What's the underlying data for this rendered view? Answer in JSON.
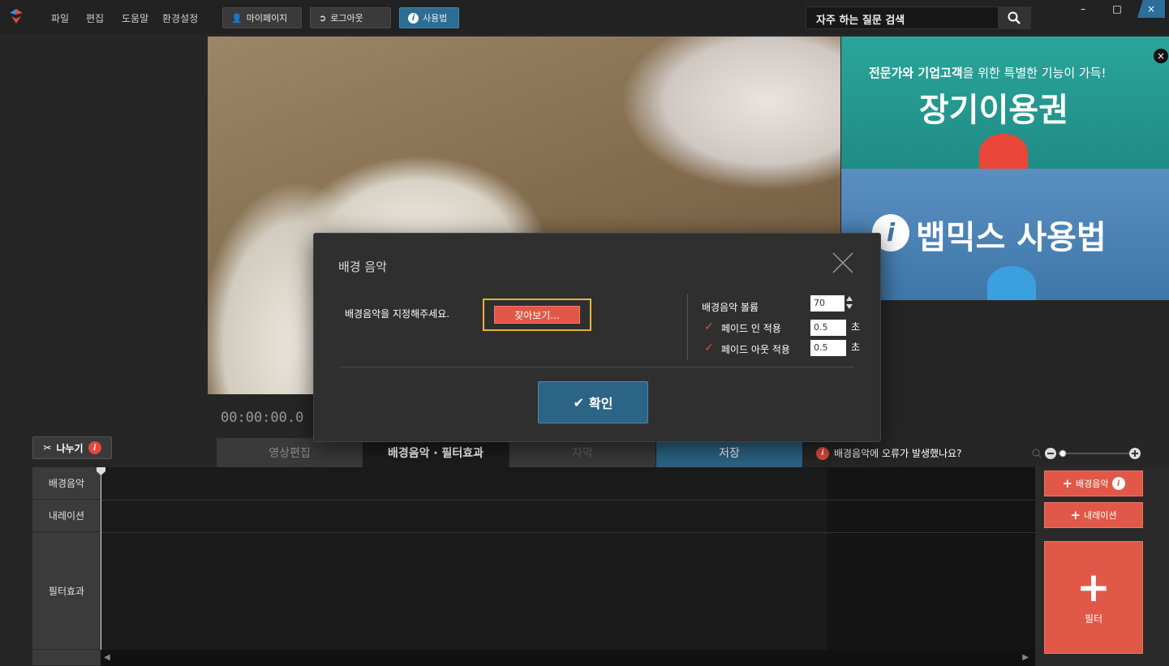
{
  "menu": [
    "파일",
    "편집",
    "도움말",
    "환경설정"
  ],
  "topbar": {
    "mypage": "마이페이지",
    "logout": "로그아웃",
    "howto": "사용법"
  },
  "search": {
    "label": "자주 하는 질문 검색"
  },
  "window": {
    "minimize": "–",
    "maximize": "□",
    "close": "×"
  },
  "ads": {
    "ad1_sub_prefix": "전문가와 기업고객",
    "ad1_sub_suffix": "을 위한 특별한 기능이 가득!",
    "ad1_main": "장기이용권",
    "ad2_main": "뱁믹스 사용법",
    "close": "×"
  },
  "player": {
    "timecode": "00:00:00.0"
  },
  "split": {
    "label": "나누기"
  },
  "tabs": [
    {
      "label": "영상편집"
    },
    {
      "label": "배경음악 · 필터효과"
    },
    {
      "label": "자막"
    },
    {
      "label": "저장"
    }
  ],
  "error_help": "배경음악에 오류가 발생했나요?",
  "timeline": {
    "tracks": [
      "배경음악",
      "내레이션",
      "필터효과"
    ]
  },
  "actions": {
    "add_bgm": "배경음악",
    "add_narration": "내레이션",
    "add_filter": "필터"
  },
  "dialog": {
    "title": "배경 음악",
    "prompt": "배경음악을 지정해주세요.",
    "browse": "찾아보기...",
    "volume_label": "배경음악 볼륨",
    "volume": "70",
    "fade_in_label": "페이드 인 적용",
    "fade_in": "0.5",
    "fade_out_label": "페이드 아웃 적용",
    "fade_out": "0.5",
    "unit": "초",
    "ok": "확인"
  },
  "colors": {
    "accent_red": "#e15848",
    "accent_blue": "#2c6e93",
    "highlight": "#e9b431"
  }
}
